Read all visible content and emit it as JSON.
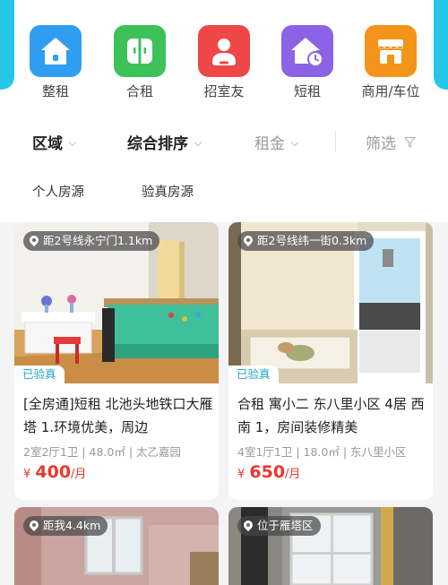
{
  "categories": [
    {
      "label": "整租",
      "color": "#2f9ef0",
      "icon": "house-icon"
    },
    {
      "label": "合租",
      "color": "#3dc25a",
      "icon": "shared-room-icon"
    },
    {
      "label": "招室友",
      "color": "#ee4746",
      "icon": "roommate-icon"
    },
    {
      "label": "短租",
      "color": "#8b63e6",
      "icon": "short-rent-icon"
    },
    {
      "label": "商用/车位",
      "color": "#f3931a",
      "icon": "shop-icon"
    }
  ],
  "filters": {
    "area": "区域",
    "sort": "综合排序",
    "rent": "租金",
    "screen": "筛选"
  },
  "tags": {
    "personal": "个人房源",
    "verified": "验真房源"
  },
  "listings": [
    {
      "location": "距2号线永宁门1.1km",
      "verified_label": "已验真",
      "title": "[全房通]短租 北池头地铁口大雁塔 1.环境优美，周边",
      "meta": "2室2厅1卫 | 48.0㎡ | 太乙嘉园",
      "price_prefix": "¥",
      "price": "400",
      "price_unit": "/月"
    },
    {
      "location": "距2号线纬一街0.3km",
      "verified_label": "已验真",
      "title": "合租 寓小二 东八里小区 4居 西南 1，房间装修精美",
      "meta": "4室1厅1卫 | 18.0㎡ | 东八里小区",
      "price_prefix": "¥",
      "price": "650",
      "price_unit": "/月"
    },
    {
      "location": "距我4.4km"
    },
    {
      "location": "位于雁塔区"
    }
  ],
  "colors": {
    "accent": "#25c6e8",
    "price": "#e8382f",
    "verified": "#1ca6c9"
  }
}
